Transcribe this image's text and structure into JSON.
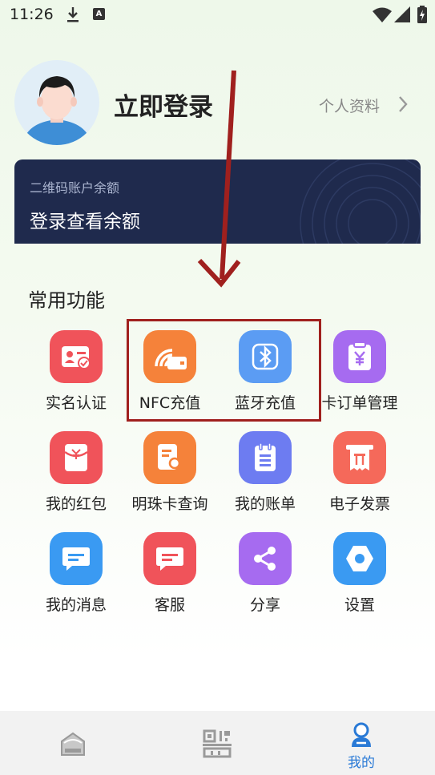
{
  "status_bar": {
    "time": "11:26",
    "a_badge": "A"
  },
  "profile": {
    "login_title": "立即登录",
    "profile_link": "个人资料"
  },
  "balance_card": {
    "label": "二维码账户余额",
    "value": "登录查看余额"
  },
  "section_title": "常用功能",
  "functions": [
    {
      "label": "实名认证",
      "icon": "id-card-icon",
      "color": "#f0535a"
    },
    {
      "label": "NFC充值",
      "icon": "nfc-card-icon",
      "color": "#f5823a"
    },
    {
      "label": "蓝牙充值",
      "icon": "bluetooth-icon",
      "color": "#5b9cf3"
    },
    {
      "label": "卡订单管理",
      "icon": "yuan-order-icon",
      "color": "#a66bf0"
    },
    {
      "label": "我的红包",
      "icon": "red-envelope-icon",
      "color": "#f0535a"
    },
    {
      "label": "明珠卡查询",
      "icon": "card-search-icon",
      "color": "#f5823a"
    },
    {
      "label": "我的账单",
      "icon": "bill-icon",
      "color": "#6d7cf1"
    },
    {
      "label": "电子发票",
      "icon": "invoice-icon",
      "color": "#f5695a"
    },
    {
      "label": "我的消息",
      "icon": "message-icon",
      "color": "#3a9af2"
    },
    {
      "label": "客服",
      "icon": "customer-service-icon",
      "color": "#f0535a"
    },
    {
      "label": "分享",
      "icon": "share-icon",
      "color": "#a66bf0"
    },
    {
      "label": "设置",
      "icon": "settings-icon",
      "color": "#3a9af2"
    }
  ],
  "bottom_nav": {
    "mine_label": "我的",
    "active_color": "#2a7ad6"
  }
}
